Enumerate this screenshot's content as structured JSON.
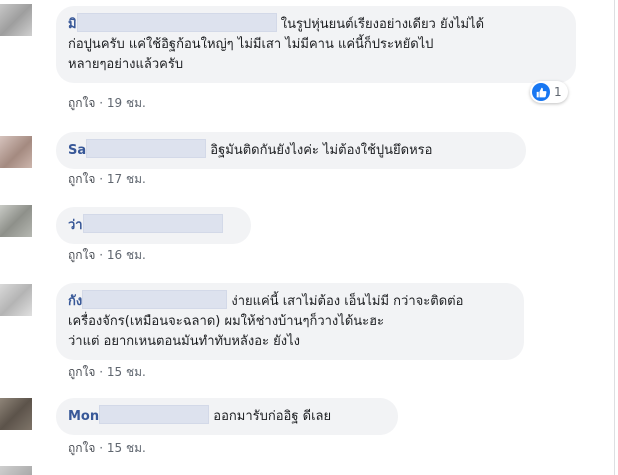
{
  "comments": [
    {
      "name_partial": "มิ",
      "text": "ในรูปหุ่นยนต์เรียงอย่างเดียว ยังไม่ได้\nก่อปูนครับ แค่ใช้อิฐก้อนใหญ่ๆ ไม่มีเสา ไม่มีคาน แค่นี้ก็ประหยัดไป\nหลายๆอย่างแล้วครับ",
      "like_label": "ถูกใจ",
      "separator": "·",
      "time": "19 ชม.",
      "reaction_icon": "like-thumb-icon",
      "reaction_count": "1"
    },
    {
      "name_partial": "Sa",
      "text": "อิฐมันติดกันยังไงค่ะ ไม่ต้องใช้ปูนยึดหรอ",
      "like_label": "ถูกใจ",
      "separator": "·",
      "time": "17 ชม."
    },
    {
      "name_partial": "ว่า",
      "text": "",
      "like_label": "ถูกใจ",
      "separator": "·",
      "time": "16 ชม."
    },
    {
      "name_partial": "กัง",
      "text": "ง่ายแค่นี้ เสาไม่ต้อง เอ็นไม่มี กว่าจะติดต่อ\nเครื่องจักร(เหมือนจะฉลาด) ผมให้ช่างบ้านๆก็วางได้นะฮะ\nว่าแต่ อยากเหนตอนมันทำทับหลังอะ ยังไง",
      "like_label": "ถูกใจ",
      "separator": "·",
      "time": "15 ชม."
    },
    {
      "name_partial": "Mon",
      "text": "ออกมารับก่ออิฐ ดีเลย",
      "like_label": "ถูกใจ",
      "separator": "·",
      "time": "15 ชม."
    }
  ],
  "colors": {
    "name": "#385898",
    "bubble": "#f2f3f5",
    "meta": "#606770",
    "like_reaction": "#1877f2"
  }
}
